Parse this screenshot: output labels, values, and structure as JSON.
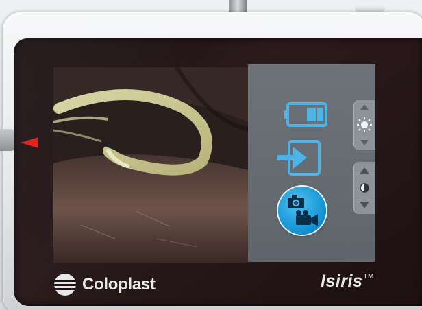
{
  "device": {
    "brand": "Coloplast",
    "product": "Isiris",
    "trademark": "TM"
  },
  "icons": {
    "battery": "battery-icon",
    "import": "import-icon",
    "record": "camera-video-record-icon",
    "brightness_up": "arrow-up-icon",
    "brightness_symbol": "sun-icon",
    "brightness_down": "arrow-down-icon",
    "contrast_up": "arrow-up-icon",
    "contrast_symbol": "contrast-icon",
    "contrast_down": "arrow-down-icon"
  },
  "status": {
    "battery_level": 0.5
  },
  "colors": {
    "accent": "#1796d8",
    "icon": "#4fb3e6",
    "panel": "#6d7479",
    "marker": "#e0251f"
  }
}
